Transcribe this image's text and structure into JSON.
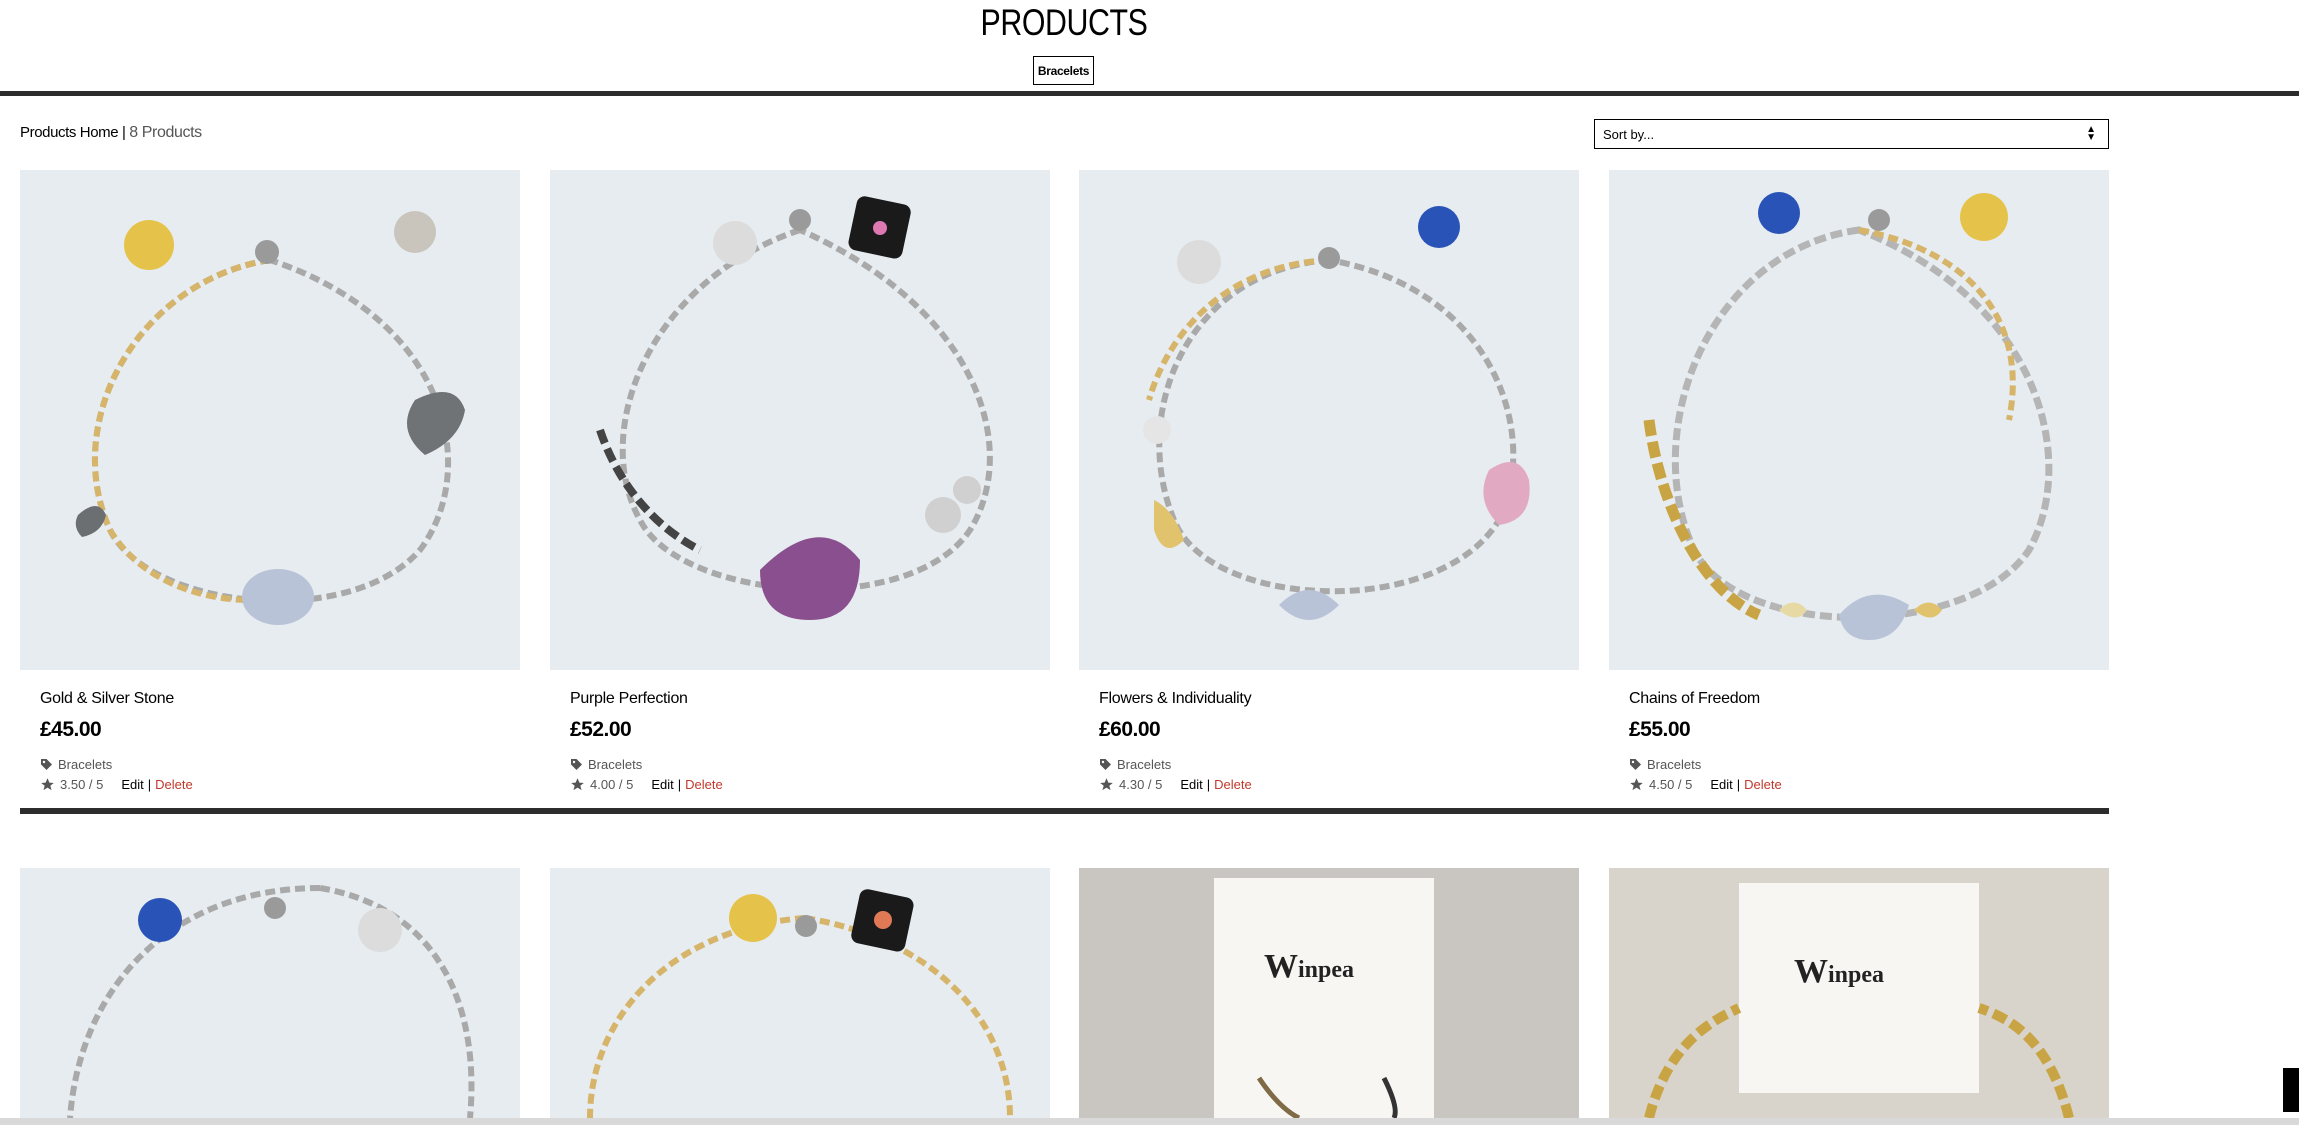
{
  "header": {
    "title": "PRODUCTS",
    "filter_badge": "Bracelets"
  },
  "toolbar": {
    "breadcrumb_home": "Products Home",
    "breadcrumb_sep": " | ",
    "product_count": "8 Products",
    "sort_placeholder": "Sort by..."
  },
  "products": [
    {
      "name": "Gold & Silver Stone",
      "price": "£45.00",
      "category": "Bracelets",
      "rating": "3.50 / 5",
      "edit": "Edit",
      "sep": "|",
      "delete": "Delete"
    },
    {
      "name": "Purple Perfection",
      "price": "£52.00",
      "category": "Bracelets",
      "rating": "4.00 / 5",
      "edit": "Edit",
      "sep": "|",
      "delete": "Delete"
    },
    {
      "name": "Flowers & Individuality",
      "price": "£60.00",
      "category": "Bracelets",
      "rating": "4.30 / 5",
      "edit": "Edit",
      "sep": "|",
      "delete": "Delete"
    },
    {
      "name": "Chains of Freedom",
      "price": "£55.00",
      "category": "Bracelets",
      "rating": "4.50 / 5",
      "edit": "Edit",
      "sep": "|",
      "delete": "Delete"
    }
  ],
  "second_row": {
    "card_brand_text_1": "inpea",
    "card_brand_text_2": "inpea"
  },
  "colors": {
    "delete": "#c0392b",
    "rule": "#2c2c2c",
    "photo_bg": "#e6ecef"
  },
  "icons": {
    "tag": "tag-icon",
    "star": "star-icon",
    "sort_arrows": "sort-arrows-icon"
  }
}
